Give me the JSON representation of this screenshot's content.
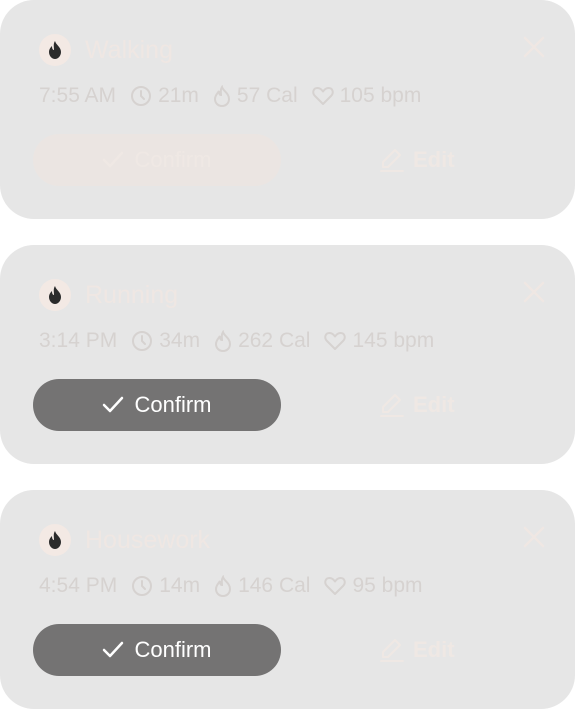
{
  "activities": [
    {
      "title": "Walking",
      "time": "7:55 AM",
      "duration": "21m",
      "calories": "57 Cal",
      "heart_rate": "105 bpm",
      "confirm_label": "Confirm",
      "confirm_state": "disabled",
      "edit_label": "Edit"
    },
    {
      "title": "Running",
      "time": "3:14 PM",
      "duration": "34m",
      "calories": "262 Cal",
      "heart_rate": "145 bpm",
      "confirm_label": "Confirm",
      "confirm_state": "active",
      "edit_label": "Edit"
    },
    {
      "title": "Housework",
      "time": "4:54 PM",
      "duration": "14m",
      "calories": "146 Cal",
      "heart_rate": "95 bpm",
      "confirm_label": "Confirm",
      "confirm_state": "active",
      "edit_label": "Edit"
    }
  ],
  "icons": {
    "badge": "flame-icon",
    "close": "close-icon",
    "duration": "clock-icon",
    "calories": "flame-outline-icon",
    "heart_rate": "heart-icon",
    "confirm": "check-icon",
    "edit": "pencil-icon"
  },
  "colors": {
    "card_bg": "#e6e6e6",
    "confirm_active_bg": "#747373",
    "flame": "#2b2b2b"
  }
}
